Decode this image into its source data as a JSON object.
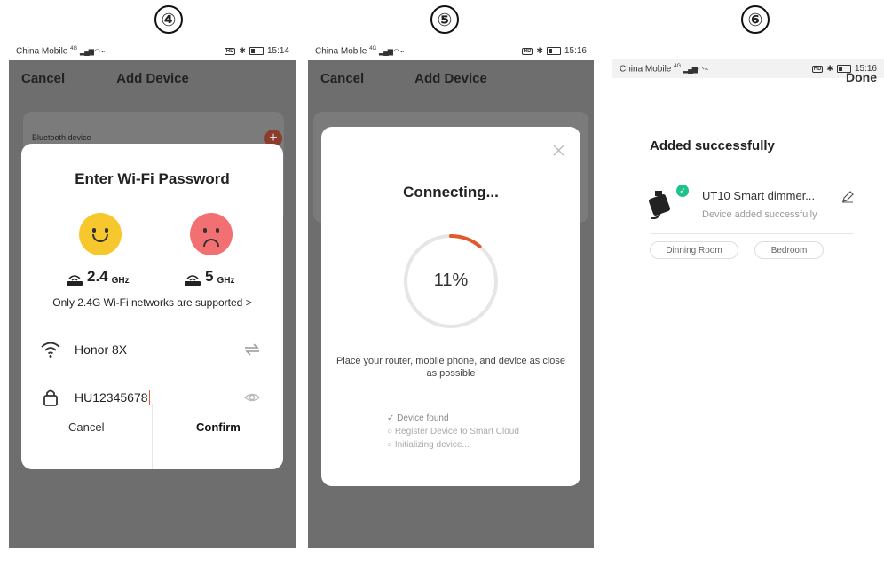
{
  "steps": [
    "④",
    "⑤",
    "⑥"
  ],
  "phones": [
    {
      "carrier": "China Mobile",
      "network": "4G",
      "time": "15:14"
    },
    {
      "carrier": "China Mobile",
      "network": "4G",
      "time": "15:16"
    },
    {
      "carrier": "China Mobile",
      "network": "4G",
      "time": "15:16"
    }
  ],
  "nav": {
    "cancel": "Cancel",
    "title": "Add Device"
  },
  "background_card": {
    "label": "Bluetooth device"
  },
  "wifi_modal": {
    "title": "Enter Wi-Fi Password",
    "freq_a_number": "2.4",
    "freq_a_unit": "GHz",
    "freq_b_number": "5",
    "freq_b_unit": "GHz",
    "note": "Only 2.4G Wi-Fi networks are supported >",
    "ssid": "Honor 8X",
    "password": "HU12345678",
    "cancel": "Cancel",
    "confirm": "Confirm"
  },
  "connecting_modal": {
    "title": "Connecting...",
    "progress_percent": 11,
    "progress_label": "11%",
    "tip": "Place your router, mobile phone, and device as close as possible",
    "steps": [
      {
        "label": "Device found",
        "done": true
      },
      {
        "label": "Register Device to Smart Cloud",
        "done": false
      },
      {
        "label": "Initializing device...",
        "done": false
      }
    ]
  },
  "result": {
    "done": "Done",
    "title": "Added successfully",
    "device_name": "UT10 Smart dimmer...",
    "device_status": "Device added successfully",
    "rooms": [
      "Dinning Room",
      "Bedroom"
    ]
  },
  "colors": {
    "overlay": "#6e6e6e",
    "accent": "#e05a2a",
    "success": "#1ec28b",
    "happy": "#f7c72e",
    "sad": "#f26f72"
  },
  "icons": [
    "wifi-icon",
    "lock-icon",
    "swap-icon",
    "eye-icon",
    "close-icon",
    "edit-icon",
    "check-icon",
    "router-icon"
  ]
}
